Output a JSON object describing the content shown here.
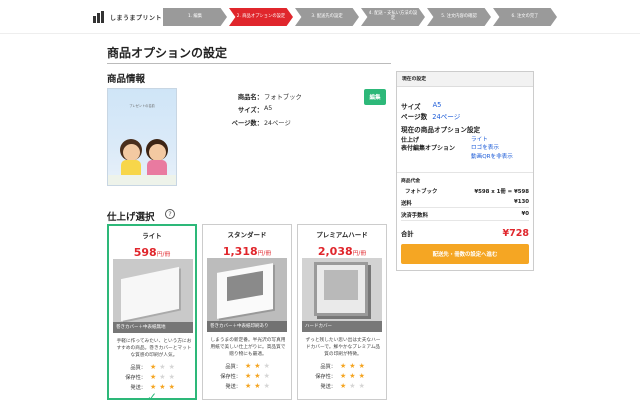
{
  "header": {
    "logo_text": "しまうまプリント",
    "steps": [
      {
        "label": "1. 編集",
        "active": false
      },
      {
        "label": "2. 商品オプションの設定",
        "active": true
      },
      {
        "label": "3. 配送先の設定",
        "active": false
      },
      {
        "label": "4. 配送・支払い方法の設定",
        "active": false
      },
      {
        "label": "5. 注文内容の確認",
        "active": false
      },
      {
        "label": "6. 注文の完了",
        "active": false
      }
    ]
  },
  "page": {
    "title": "商品オプションの設定",
    "info_section_title": "商品情報",
    "finish_section_title": "仕上げ選択",
    "help_symbol": "?"
  },
  "product": {
    "book_title": "プレゼントの名前",
    "rows": [
      {
        "key": "商品名：",
        "value": "フォトブック"
      },
      {
        "key": "サイズ：",
        "value": "A5"
      },
      {
        "key": "ページ数：",
        "value": "24ページ"
      }
    ],
    "edit_label": "編集"
  },
  "cards": [
    {
      "name": "ライト",
      "price": "598",
      "unit": "円/冊",
      "photo_caption": "巻きカバー＋中表紙無地",
      "desc": "手軽に作ってみたい、という方におすすめの商品。巻きカバーとマットな質感の印刷が人気。",
      "ratings": [
        {
          "label": "品質：",
          "stars": 1
        },
        {
          "label": "保存性：",
          "stars": 1
        },
        {
          "label": "発送：",
          "stars": 3
        }
      ],
      "selected": true,
      "check": "✓"
    },
    {
      "name": "スタンダード",
      "price": "1,318",
      "unit": "円/冊",
      "photo_caption": "巻きカバー＋中表紙印刷あり",
      "desc": "しまうまの新定番。半光沢の写真用用紙で美しい仕上がりに。高品質で贈り物にも最適。",
      "ratings": [
        {
          "label": "品質：",
          "stars": 2
        },
        {
          "label": "保存性：",
          "stars": 2
        },
        {
          "label": "発送：",
          "stars": 2
        }
      ],
      "selected": false
    },
    {
      "name": "プレミアムハード",
      "price": "2,038",
      "unit": "円/冊",
      "photo_caption": "ハードカバー",
      "desc": "ずっと残したい思い出は丈夫なハードカバーで。鮮やかなプレミアム品質の印刷が特徴。",
      "ratings": [
        {
          "label": "品質：",
          "stars": 3
        },
        {
          "label": "保存性：",
          "stars": 3
        },
        {
          "label": "発送：",
          "stars": 1
        }
      ],
      "selected": false
    }
  ],
  "side": {
    "header": "現在の設定",
    "size_key": "サイズ",
    "size_value": "A5",
    "pages_key": "ページ数",
    "pages_value": "24ページ",
    "current_options_title": "現在の商品オプション設定",
    "finish_key": "仕上げ",
    "cover_key": "表付編集オプション",
    "options": [
      "ライト",
      "ロゴを表示",
      "動画QRを非表示"
    ],
    "price_title": "商品代金",
    "price_rows": [
      {
        "key": "フォトブック",
        "value": "¥598 x 1冊 = ¥598"
      },
      {
        "key": "送料",
        "value": "¥130"
      },
      {
        "key": "決済手数料",
        "value": "¥0"
      }
    ],
    "total_key": "合計",
    "total_value": "¥728",
    "cta_label": "配送先・冊数の設定へ進む"
  },
  "colors": {
    "accent_red": "#e0262c",
    "accent_green": "#2db879",
    "cta_orange": "#f5a623",
    "link_blue": "#1a5ad7"
  }
}
